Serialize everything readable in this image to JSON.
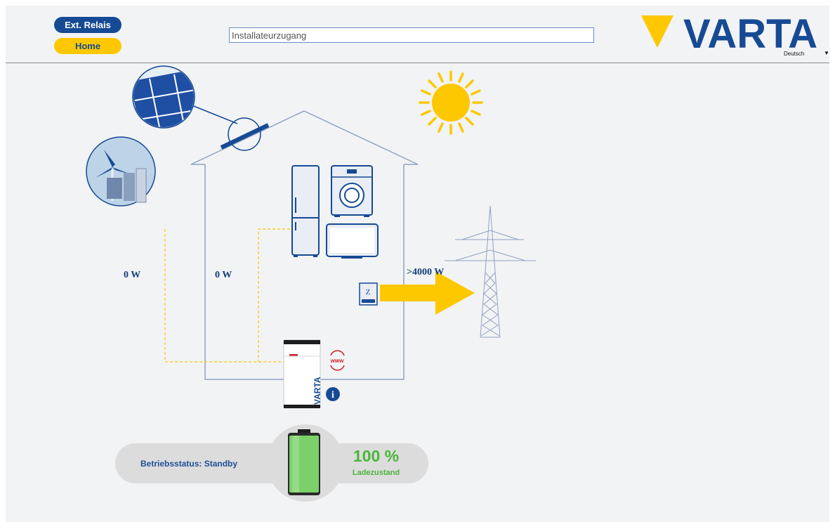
{
  "nav": {
    "ext_relais": "Ext. Relais",
    "home": "Home"
  },
  "search": {
    "value": "",
    "placeholder": "Installateurzugang"
  },
  "brand": {
    "logo_text": "VARTA",
    "primary_color": "#164a94",
    "accent_color": "#fdc800"
  },
  "language": {
    "selected": "Deutsch",
    "arrow": "▼"
  },
  "energy_flow": {
    "wind_power": "0 W",
    "pv_power": "0 W",
    "grid_power": ">4000 W"
  },
  "device": {
    "brand_label": "VARTA",
    "www_label": "www",
    "info_label": "i"
  },
  "status": {
    "operating_status": "Betriebsstatus: Standby",
    "soc_value": "100 %",
    "soc_label": "Ladezustand",
    "soc_fraction": 1.0,
    "soc_color": "#4ab63a"
  }
}
